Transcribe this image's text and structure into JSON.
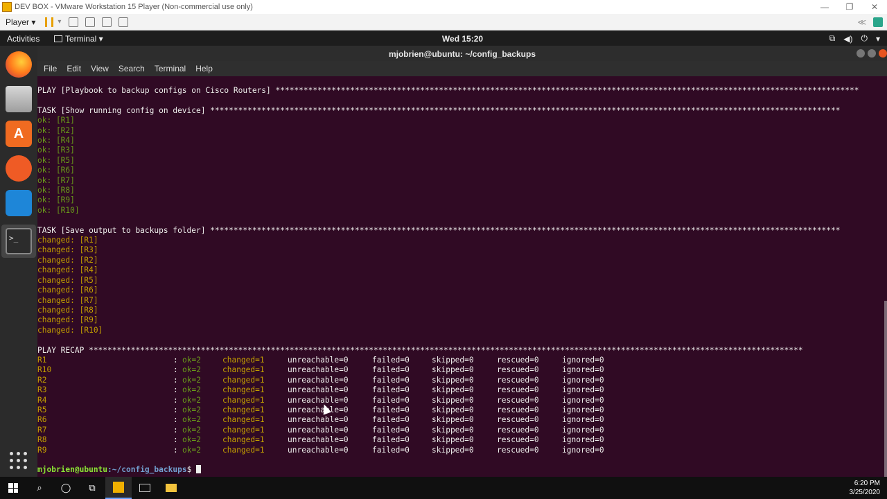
{
  "vm": {
    "title": "DEV BOX - VMware Workstation 15 Player (Non-commercial use only)",
    "player_menu": "Player ▾",
    "minimize": "—",
    "restore": "❐",
    "close": "✕",
    "collapse": "≪"
  },
  "gnome": {
    "activities": "Activities",
    "app_label": "Terminal ▾",
    "clock": "Wed 15:20",
    "tray_icons": [
      "network-icon",
      "volume-icon",
      "power-icon"
    ]
  },
  "terminal": {
    "title": "mjobrien@ubuntu: ~/config_backups",
    "menu": [
      "File",
      "Edit",
      "View",
      "Search",
      "Terminal",
      "Help"
    ],
    "lines": [
      {
        "cls": "c-def",
        "text": "PLAY [Playbook to backup configs on Cisco Routers] *****************************************************************************************************************************"
      },
      {
        "cls": "c-def",
        "text": ""
      },
      {
        "cls": "c-def",
        "text": "TASK [Show running config on device] ***************************************************************************************************************************************"
      },
      {
        "cls": "c-ok",
        "text": "ok: [R1]"
      },
      {
        "cls": "c-ok",
        "text": "ok: [R2]"
      },
      {
        "cls": "c-ok",
        "text": "ok: [R4]"
      },
      {
        "cls": "c-ok",
        "text": "ok: [R3]"
      },
      {
        "cls": "c-ok",
        "text": "ok: [R5]"
      },
      {
        "cls": "c-ok",
        "text": "ok: [R6]"
      },
      {
        "cls": "c-ok",
        "text": "ok: [R7]"
      },
      {
        "cls": "c-ok",
        "text": "ok: [R8]"
      },
      {
        "cls": "c-ok",
        "text": "ok: [R9]"
      },
      {
        "cls": "c-ok",
        "text": "ok: [R10]"
      },
      {
        "cls": "c-def",
        "text": ""
      },
      {
        "cls": "c-def",
        "text": "TASK [Save output to backups folder] ***************************************************************************************************************************************"
      },
      {
        "cls": "c-ch",
        "text": "changed: [R1]"
      },
      {
        "cls": "c-ch",
        "text": "changed: [R3]"
      },
      {
        "cls": "c-ch",
        "text": "changed: [R2]"
      },
      {
        "cls": "c-ch",
        "text": "changed: [R4]"
      },
      {
        "cls": "c-ch",
        "text": "changed: [R5]"
      },
      {
        "cls": "c-ch",
        "text": "changed: [R6]"
      },
      {
        "cls": "c-ch",
        "text": "changed: [R7]"
      },
      {
        "cls": "c-ch",
        "text": "changed: [R8]"
      },
      {
        "cls": "c-ch",
        "text": "changed: [R9]"
      },
      {
        "cls": "c-ch",
        "text": "changed: [R10]"
      },
      {
        "cls": "c-def",
        "text": ""
      },
      {
        "cls": "c-def",
        "text": "PLAY RECAP *********************************************************************************************************************************************************"
      }
    ],
    "recap": [
      {
        "host": "R1"
      },
      {
        "host": "R10"
      },
      {
        "host": "R2"
      },
      {
        "host": "R3"
      },
      {
        "host": "R4"
      },
      {
        "host": "R5"
      },
      {
        "host": "R6"
      },
      {
        "host": "R7"
      },
      {
        "host": "R8"
      },
      {
        "host": "R9"
      }
    ],
    "recap_fields": {
      "sep": ": ",
      "ok": "ok=2",
      "changed": "changed=1",
      "unreachable": "unreachable=0",
      "failed": "failed=0",
      "skipped": "skipped=0",
      "rescued": "rescued=0",
      "ignored": "ignored=0"
    },
    "prompt_user": "mjobrien@ubuntu",
    "prompt_path": ":~/config_backups",
    "prompt_symbol": "$ "
  },
  "taskbar": {
    "time": "6:20 PM",
    "date": "3/25/2020"
  }
}
